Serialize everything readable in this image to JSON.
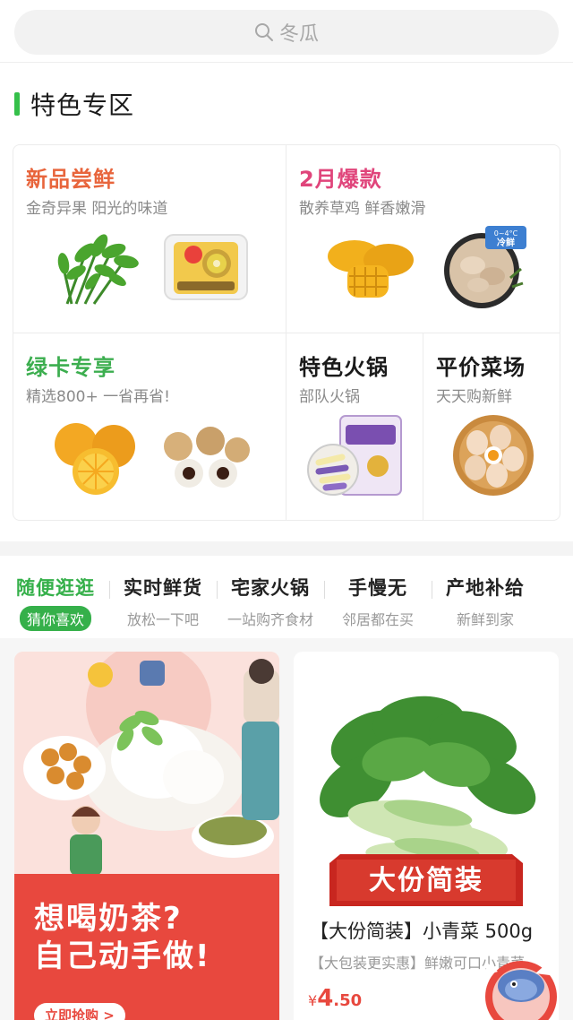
{
  "search": {
    "placeholder": "冬瓜",
    "icon": "search-icon"
  },
  "section": {
    "title": "特色专区"
  },
  "featured": [
    {
      "title": "新品尝鲜",
      "subtitle": "金奇异果 阳光的味道",
      "color": "#e8653c"
    },
    {
      "title": "2月爆款",
      "subtitle": "散养草鸡 鲜香嫩滑",
      "color": "#e0457b"
    },
    {
      "title": "绿卡专享",
      "subtitle": "精选800+ 一省再省!",
      "color": "#3cae4f"
    },
    {
      "title": "特色火锅",
      "subtitle": "部队火锅",
      "color": "#1a1a1a"
    },
    {
      "title": "平价菜场",
      "subtitle": "天天购新鲜",
      "color": "#1a1a1a"
    }
  ],
  "labels": {
    "cold_fresh": "冷鲜",
    "cold_temp": "0~4°C"
  },
  "tabs": [
    {
      "title": "随便逛逛",
      "subtitle": "猜你喜欢",
      "active": true
    },
    {
      "title": "实时鲜货",
      "subtitle": "放松一下吧",
      "active": false
    },
    {
      "title": "宅家火锅",
      "subtitle": "一站购齐食材",
      "active": false
    },
    {
      "title": "手慢无",
      "subtitle": "邻居都在买",
      "active": false
    },
    {
      "title": "产地补给",
      "subtitle": "新鲜到家",
      "active": false
    }
  ],
  "promo": {
    "line1": "想喝奶茶?",
    "line2": "自己动手做!",
    "button": "立即抢购 >"
  },
  "product": {
    "ribbon": "大份简装",
    "name": "【大份简装】小青菜 500g",
    "desc": "【大包装更实惠】鲜嫩可口小青菜",
    "currency": "¥",
    "price_int": "4",
    "price_dec": ".50"
  },
  "colors": {
    "accent": "#35b04a",
    "promo_red": "#e8483e"
  }
}
